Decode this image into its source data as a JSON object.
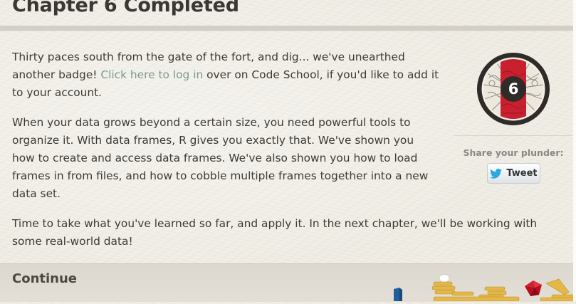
{
  "page": {
    "title": "Chapter 6 Completed"
  },
  "intro": {
    "text_before": "Thirty paces south from the gate of the fort, and dig... we've unearthed another badge! ",
    "link_text": "Click here to log in",
    "text_after": " over on Code School, if you'd like to add it to your account."
  },
  "paragraphs": [
    "When your data grows beyond a certain size, you need powerful tools to organize it. With data frames, R gives you exactly that. We've shown you how to create and access data frames. We've also shown you how to load frames in from files, and how to cobble multiple frames together into a new data set.",
    "Time to take what you've learned so far, and apply it. In the next chapter, we'll be working with some real-world data!"
  ],
  "badge": {
    "number": "6",
    "ring_color": "#2e2b28",
    "stripe_color": "#c8202f",
    "icon": "chapter-badge-icon"
  },
  "share": {
    "label": "Share your plunder:",
    "tweet_label": "Tweet",
    "twitter_color": "#2ba9e1",
    "icon": "twitter-bird-icon"
  },
  "footer": {
    "continue_label": "Continue",
    "decoration_icon": "treasure-pile-icon"
  }
}
